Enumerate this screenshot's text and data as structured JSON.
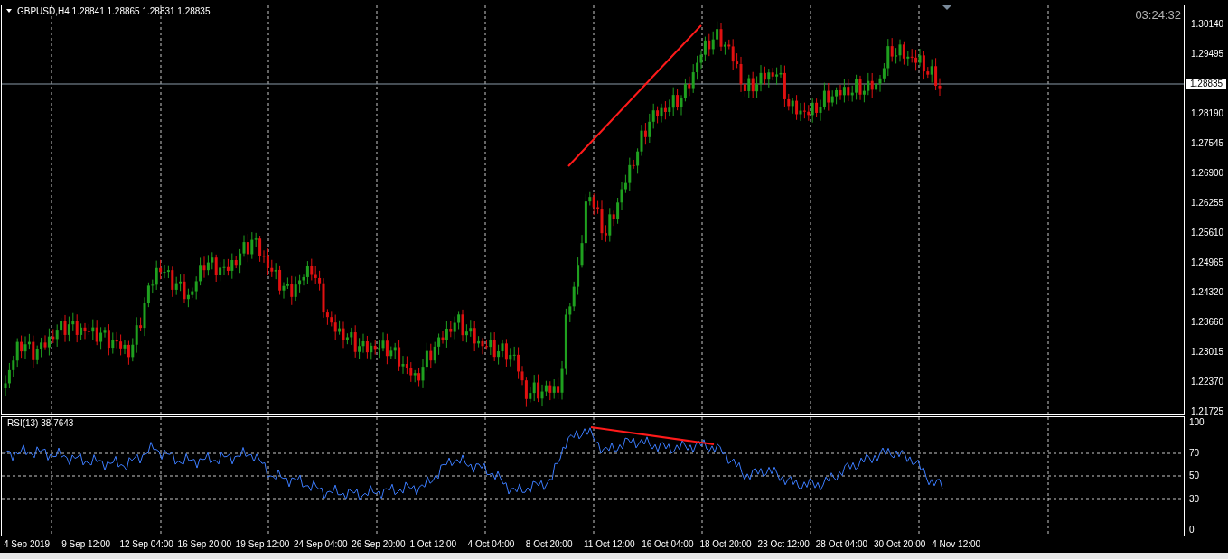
{
  "chart_header": {
    "symbol": "GBPUSD,H4",
    "quotes": "1.28841 1.28865 1.28831 1.28835"
  },
  "clock": "03:24:32",
  "price_axis": [
    "1.30140",
    "1.29495",
    "1.28190",
    "1.27545",
    "1.26900",
    "1.26255",
    "1.25610",
    "1.24965",
    "1.24320",
    "1.23660",
    "1.23015",
    "1.22370",
    "1.21725"
  ],
  "current_price": "1.28835",
  "indicator": {
    "label": "RSI(13) 38.7643",
    "axis": [
      "100",
      "70",
      "50",
      "30",
      "0"
    ]
  },
  "time_axis": [
    "4 Sep 2019",
    "9 Sep 12:00",
    "12 Sep 04:00",
    "16 Sep 20:00",
    "19 Sep 12:00",
    "24 Sep 04:00",
    "26 Sep 20:00",
    "1 Oct 12:00",
    "4 Oct 04:00",
    "8 Oct 20:00",
    "11 Oct 12:00",
    "16 Oct 04:00",
    "18 Oct 20:00",
    "23 Oct 12:00",
    "28 Oct 04:00",
    "30 Oct 20:00",
    "4 Nov 12:00"
  ]
}
